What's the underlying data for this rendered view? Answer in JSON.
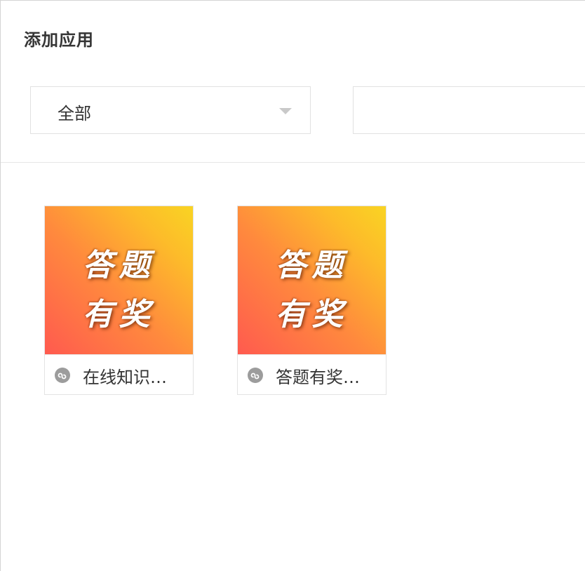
{
  "dialog": {
    "title": "添加应用"
  },
  "filter": {
    "category_value": "全部",
    "search_value": "",
    "search_placeholder": ""
  },
  "apps": [
    {
      "thumb_line1": "答题",
      "thumb_line2": "有奖",
      "label": "在线知识…",
      "icon": "mini-program-icon"
    },
    {
      "thumb_line1": "答题",
      "thumb_line2": "有奖",
      "label": "答题有奖…",
      "icon": "mini-program-icon"
    }
  ],
  "colors": {
    "thumb_gradient_start": "#ff5a4f",
    "thumb_gradient_end": "#f9d423",
    "icon_gray": "#9c9c9c"
  }
}
